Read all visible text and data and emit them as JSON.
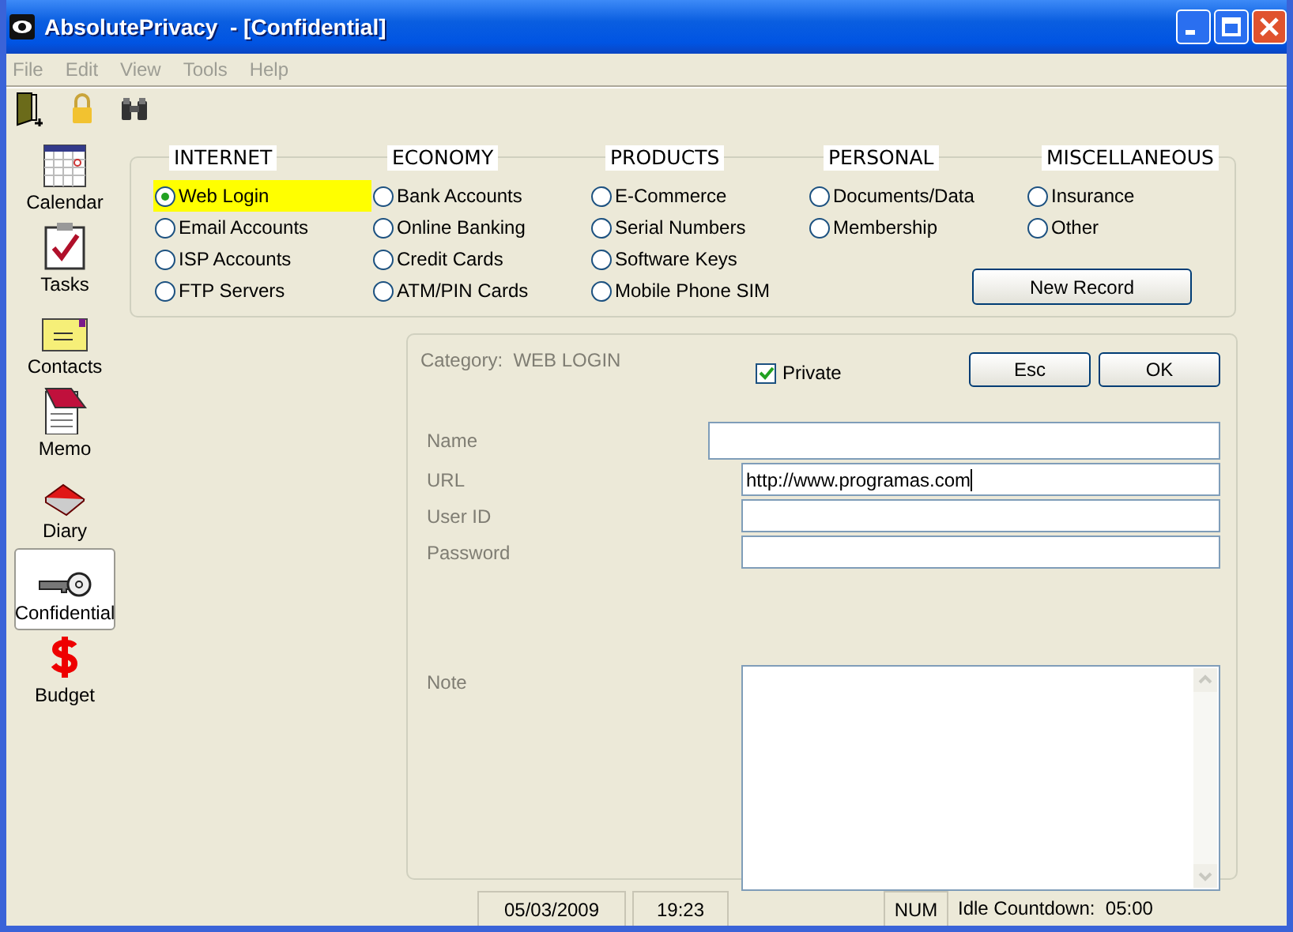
{
  "window": {
    "title": "AbsolutePrivacy  - [Confidential]"
  },
  "menu": [
    {
      "label": "File",
      "disabled": true
    },
    {
      "label": "Edit",
      "disabled": true
    },
    {
      "label": "View",
      "disabled": true
    },
    {
      "label": "Tools",
      "disabled": true
    },
    {
      "label": "Help",
      "disabled": true
    }
  ],
  "sidebar": {
    "items": [
      {
        "label": "Calendar",
        "kind": "calendar",
        "selected": false
      },
      {
        "label": "Tasks",
        "kind": "tasks",
        "selected": false
      },
      {
        "label": "Contacts",
        "kind": "contacts",
        "selected": false
      },
      {
        "label": "Memo",
        "kind": "memo",
        "selected": false
      },
      {
        "label": "Diary",
        "kind": "diary",
        "selected": false
      },
      {
        "label": "Confidential",
        "kind": "key",
        "selected": true
      },
      {
        "label": "Budget",
        "kind": "budget",
        "selected": false
      }
    ]
  },
  "categories": [
    {
      "title": "INTERNET",
      "options": [
        {
          "label": "Web Login",
          "selected": true
        },
        {
          "label": "Email Accounts",
          "selected": false
        },
        {
          "label": "ISP Accounts",
          "selected": false
        },
        {
          "label": "FTP Servers",
          "selected": false
        }
      ]
    },
    {
      "title": "ECONOMY",
      "options": [
        {
          "label": "Bank Accounts",
          "selected": false
        },
        {
          "label": "Online Banking",
          "selected": false
        },
        {
          "label": "Credit Cards",
          "selected": false
        },
        {
          "label": "ATM/PIN Cards",
          "selected": false
        }
      ]
    },
    {
      "title": "PRODUCTS",
      "options": [
        {
          "label": "E-Commerce",
          "selected": false
        },
        {
          "label": "Serial Numbers",
          "selected": false
        },
        {
          "label": "Software Keys",
          "selected": false
        },
        {
          "label": "Mobile Phone SIM",
          "selected": false
        }
      ]
    },
    {
      "title": "PERSONAL",
      "options": [
        {
          "label": "Documents/Data",
          "selected": false
        },
        {
          "label": "Membership",
          "selected": false
        }
      ]
    },
    {
      "title": "MISCELLANEOUS",
      "options": [
        {
          "label": "Insurance",
          "selected": false
        },
        {
          "label": "Other",
          "selected": false
        }
      ]
    }
  ],
  "new_record_button": "New Record",
  "form": {
    "category_label": "Category:",
    "category_value": "WEB LOGIN",
    "private": {
      "label": "Private",
      "checked": true
    },
    "buttons": [
      "Esc",
      "OK"
    ],
    "fields": [
      {
        "label": "Name"
      },
      {
        "label": "URL",
        "value": "http://www.programas.com"
      },
      {
        "label": "User ID"
      },
      {
        "label": "Password"
      }
    ],
    "note": {
      "label": "Note"
    }
  },
  "status_bar": {
    "date": "05/03/2009",
    "time": "19:23",
    "num": "NUM",
    "idle": "Idle Countdown:  05:00"
  }
}
